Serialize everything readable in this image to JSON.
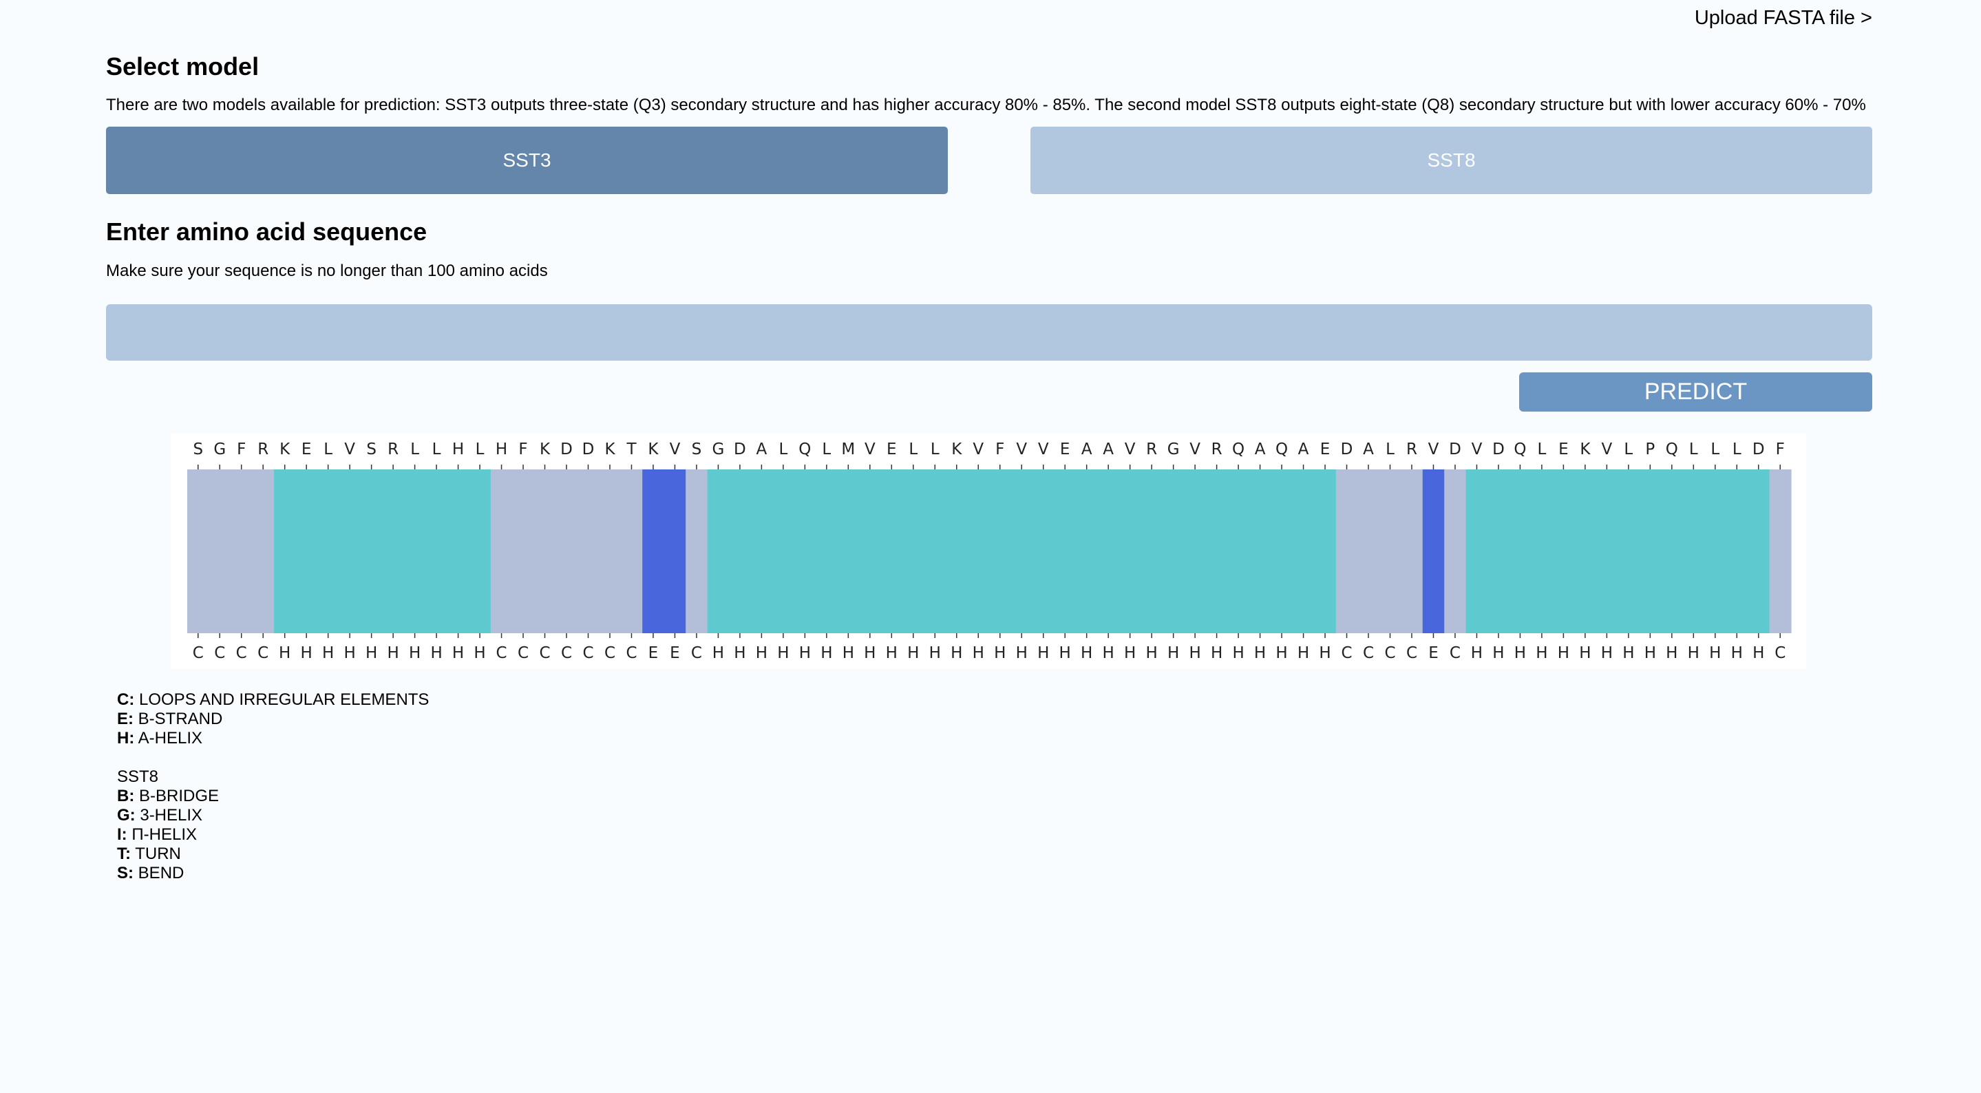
{
  "header": {
    "upload_link": "Upload FASTA file >"
  },
  "model_section": {
    "title": "Select model",
    "description": "There are two models available for prediction: SST3 outputs three-state (Q3) secondary structure and has higher accuracy 80% - 85%. The second model SST8 outputs eight-state (Q8) secondary structure but with lower accuracy 60% - 70%",
    "buttons": [
      {
        "label": "SST3",
        "selected": true
      },
      {
        "label": "SST8",
        "selected": false
      }
    ]
  },
  "sequence_section": {
    "title": "Enter amino acid sequence",
    "hint": "Make sure your sequence is no longer than 100 amino acids",
    "input_value": "",
    "predict_label": "PREDICT"
  },
  "colors": {
    "C": "#b3bfd9",
    "H": "#5ecacf",
    "E": "#4966dc"
  },
  "chart_data": {
    "type": "heatmap",
    "sequence": [
      "S",
      "G",
      "F",
      "R",
      "K",
      "E",
      "L",
      "V",
      "S",
      "R",
      "L",
      "L",
      "H",
      "L",
      "H",
      "F",
      "K",
      "D",
      "D",
      "K",
      "T",
      "K",
      "V",
      "S",
      "G",
      "D",
      "A",
      "L",
      "Q",
      "L",
      "M",
      "V",
      "E",
      "L",
      "L",
      "K",
      "V",
      "F",
      "V",
      "V",
      "E",
      "A",
      "A",
      "V",
      "R",
      "G",
      "V",
      "R",
      "Q",
      "A",
      "Q",
      "A",
      "E",
      "D",
      "A",
      "L",
      "R",
      "V",
      "D",
      "V",
      "D",
      "Q",
      "L",
      "E",
      "K",
      "V",
      "L",
      "P",
      "Q",
      "L",
      "L",
      "L",
      "D",
      "F"
    ],
    "structure": [
      "C",
      "C",
      "C",
      "C",
      "H",
      "H",
      "H",
      "H",
      "H",
      "H",
      "H",
      "H",
      "H",
      "H",
      "C",
      "C",
      "C",
      "C",
      "C",
      "C",
      "C",
      "E",
      "E",
      "C",
      "H",
      "H",
      "H",
      "H",
      "H",
      "H",
      "H",
      "H",
      "H",
      "H",
      "H",
      "H",
      "H",
      "H",
      "H",
      "H",
      "H",
      "H",
      "H",
      "H",
      "H",
      "H",
      "H",
      "H",
      "H",
      "H",
      "H",
      "H",
      "H",
      "C",
      "C",
      "C",
      "C",
      "E",
      "C",
      "H",
      "H",
      "H",
      "H",
      "H",
      "H",
      "H",
      "H",
      "H",
      "H",
      "H",
      "H",
      "H",
      "H",
      "C"
    ]
  },
  "legend": {
    "sst3": [
      {
        "code": "C:",
        "label": "LOOPS AND IRREGULAR ELEMENTS"
      },
      {
        "code": "E:",
        "label": "B-STRAND"
      },
      {
        "code": "H:",
        "label": "A-HELIX"
      }
    ],
    "sst8_title": "SST8",
    "sst8": [
      {
        "code": "B:",
        "label": "B-BRIDGE"
      },
      {
        "code": "G:",
        "label": "3-HELIX"
      },
      {
        "code": "I:",
        "label": "Π-HELIX"
      },
      {
        "code": "T:",
        "label": "TURN"
      },
      {
        "code": "S:",
        "label": "BEND"
      }
    ]
  }
}
